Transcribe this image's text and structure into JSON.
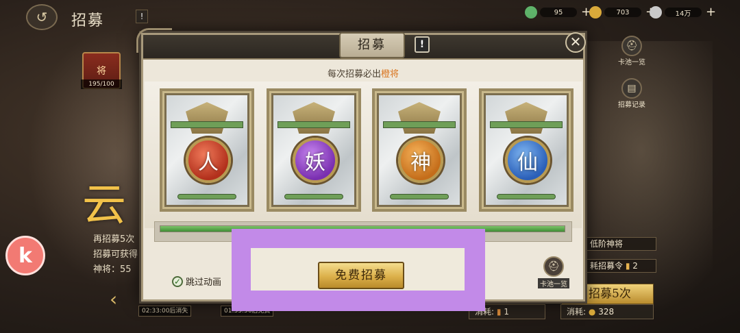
{
  "topbar": {
    "back_icon": "back-arrow-icon",
    "title": "招募",
    "warn": "!",
    "resources": [
      {
        "name": "jade",
        "value": "95",
        "color": "#5fb36a"
      },
      {
        "name": "gold",
        "value": "703",
        "color": "#d9a93a"
      },
      {
        "name": "coin",
        "value": "14万",
        "color": "#c9c9c9"
      }
    ],
    "plus": "+"
  },
  "side": {
    "pool_label": "卡池一览",
    "record_label": "招募记录"
  },
  "jiang": {
    "label": "将",
    "count": "195/100"
  },
  "left": {
    "big_char": "云",
    "line1": "再招募5次",
    "line2": "招募可获得",
    "line3": "神将：55",
    "arrow": "‹",
    "timer1": "02:33:00后消失",
    "timer2": "01:33:56后免费"
  },
  "right": {
    "row1": "低阶神将",
    "row2": "耗招募令",
    "row2_val": "2",
    "recruit5": "招募5次",
    "cost_left_label": "消耗:",
    "cost_left_val": "1",
    "cost_right_label": "消耗:",
    "cost_right_val": "328"
  },
  "modal": {
    "title": "招募",
    "warn": "!",
    "close": "✕",
    "subtitle_prefix": "每次招募必出",
    "subtitle_accent": "橙将",
    "cards": [
      {
        "char": "人",
        "color": "#c9402a"
      },
      {
        "char": "妖",
        "color": "#9b4bc4"
      },
      {
        "char": "神",
        "color": "#d98a2a"
      },
      {
        "char": "仙",
        "color": "#3a7ad0"
      }
    ],
    "progress": 1.0,
    "skip_label": "跳过动画",
    "free_button": "免费招募",
    "pool_label": "卡池一览"
  },
  "kk_icon": "k"
}
